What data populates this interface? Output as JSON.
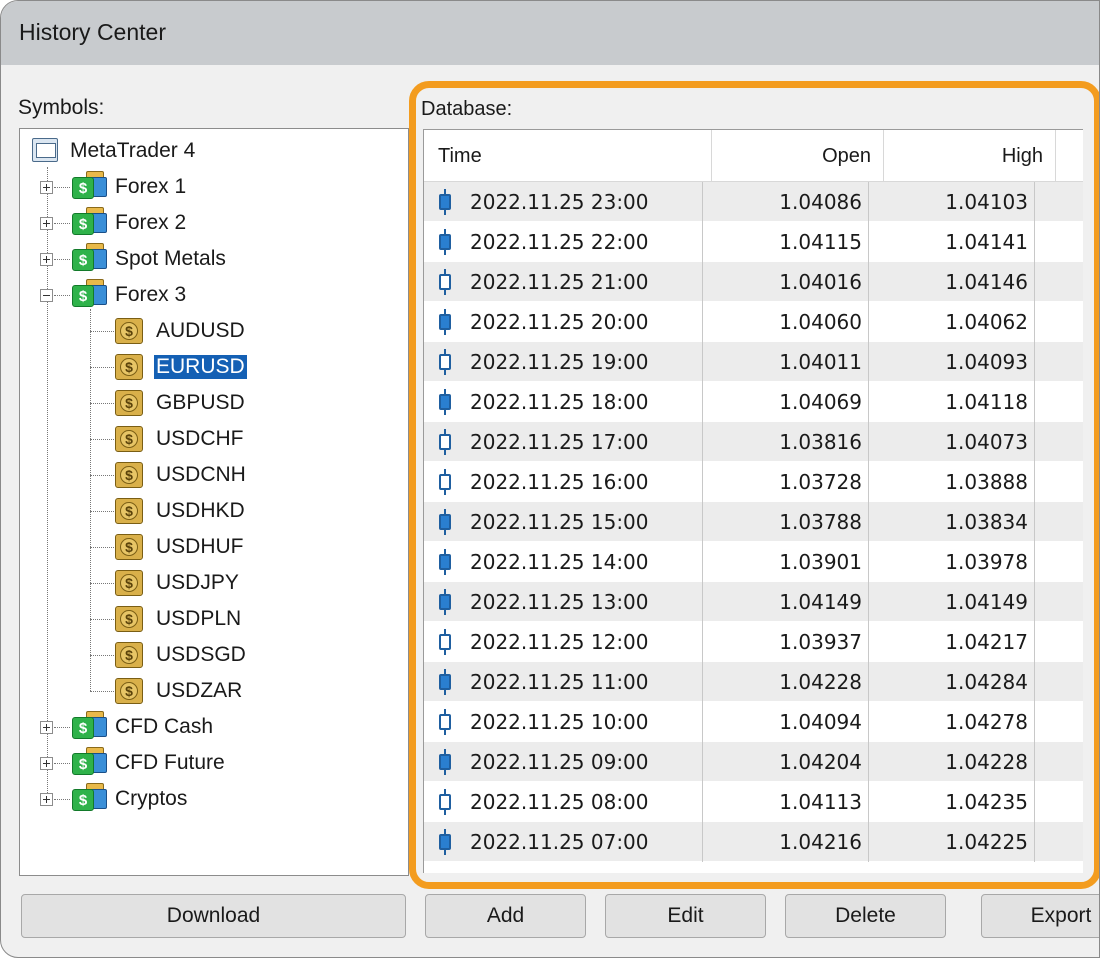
{
  "window": {
    "title": "History Center"
  },
  "symbols": {
    "label": "Symbols:",
    "root": "MetaTrader 4",
    "groups": [
      {
        "label": "Forex 1",
        "expanded": false
      },
      {
        "label": "Forex 2",
        "expanded": false
      },
      {
        "label": "Spot Metals",
        "expanded": false
      },
      {
        "label": "Forex 3",
        "expanded": true,
        "children": [
          "AUDUSD",
          "EURUSD",
          "GBPUSD",
          "USDCHF",
          "USDCNH",
          "USDHKD",
          "USDHUF",
          "USDJPY",
          "USDPLN",
          "USDSGD",
          "USDZAR"
        ]
      },
      {
        "label": "CFD Cash",
        "expanded": false
      },
      {
        "label": "CFD Future",
        "expanded": false
      },
      {
        "label": "Cryptos",
        "expanded": false
      }
    ],
    "selected": "EURUSD"
  },
  "database": {
    "label": "Database:",
    "columns": [
      "Time",
      "Open",
      "High"
    ],
    "rows": [
      {
        "time": "2022.11.25 23:00",
        "open": "1.04086",
        "high": "1.04103",
        "candle": "filled"
      },
      {
        "time": "2022.11.25 22:00",
        "open": "1.04115",
        "high": "1.04141",
        "candle": "filled"
      },
      {
        "time": "2022.11.25 21:00",
        "open": "1.04016",
        "high": "1.04146",
        "candle": "hollow"
      },
      {
        "time": "2022.11.25 20:00",
        "open": "1.04060",
        "high": "1.04062",
        "candle": "filled"
      },
      {
        "time": "2022.11.25 19:00",
        "open": "1.04011",
        "high": "1.04093",
        "candle": "hollow"
      },
      {
        "time": "2022.11.25 18:00",
        "open": "1.04069",
        "high": "1.04118",
        "candle": "filled"
      },
      {
        "time": "2022.11.25 17:00",
        "open": "1.03816",
        "high": "1.04073",
        "candle": "hollow"
      },
      {
        "time": "2022.11.25 16:00",
        "open": "1.03728",
        "high": "1.03888",
        "candle": "hollow"
      },
      {
        "time": "2022.11.25 15:00",
        "open": "1.03788",
        "high": "1.03834",
        "candle": "filled"
      },
      {
        "time": "2022.11.25 14:00",
        "open": "1.03901",
        "high": "1.03978",
        "candle": "filled"
      },
      {
        "time": "2022.11.25 13:00",
        "open": "1.04149",
        "high": "1.04149",
        "candle": "filled"
      },
      {
        "time": "2022.11.25 12:00",
        "open": "1.03937",
        "high": "1.04217",
        "candle": "hollow"
      },
      {
        "time": "2022.11.25 11:00",
        "open": "1.04228",
        "high": "1.04284",
        "candle": "filled"
      },
      {
        "time": "2022.11.25 10:00",
        "open": "1.04094",
        "high": "1.04278",
        "candle": "hollow"
      },
      {
        "time": "2022.11.25 09:00",
        "open": "1.04204",
        "high": "1.04228",
        "candle": "filled"
      },
      {
        "time": "2022.11.25 08:00",
        "open": "1.04113",
        "high": "1.04235",
        "candle": "hollow"
      },
      {
        "time": "2022.11.25 07:00",
        "open": "1.04216",
        "high": "1.04225",
        "candle": "filled"
      }
    ]
  },
  "buttons": {
    "download": "Download",
    "add": "Add",
    "edit": "Edit",
    "delete": "Delete",
    "export": "Export"
  },
  "colors": {
    "highlight_frame": "#f39c1f",
    "selection": "#1460b4",
    "candle": "#1f5fa0"
  }
}
